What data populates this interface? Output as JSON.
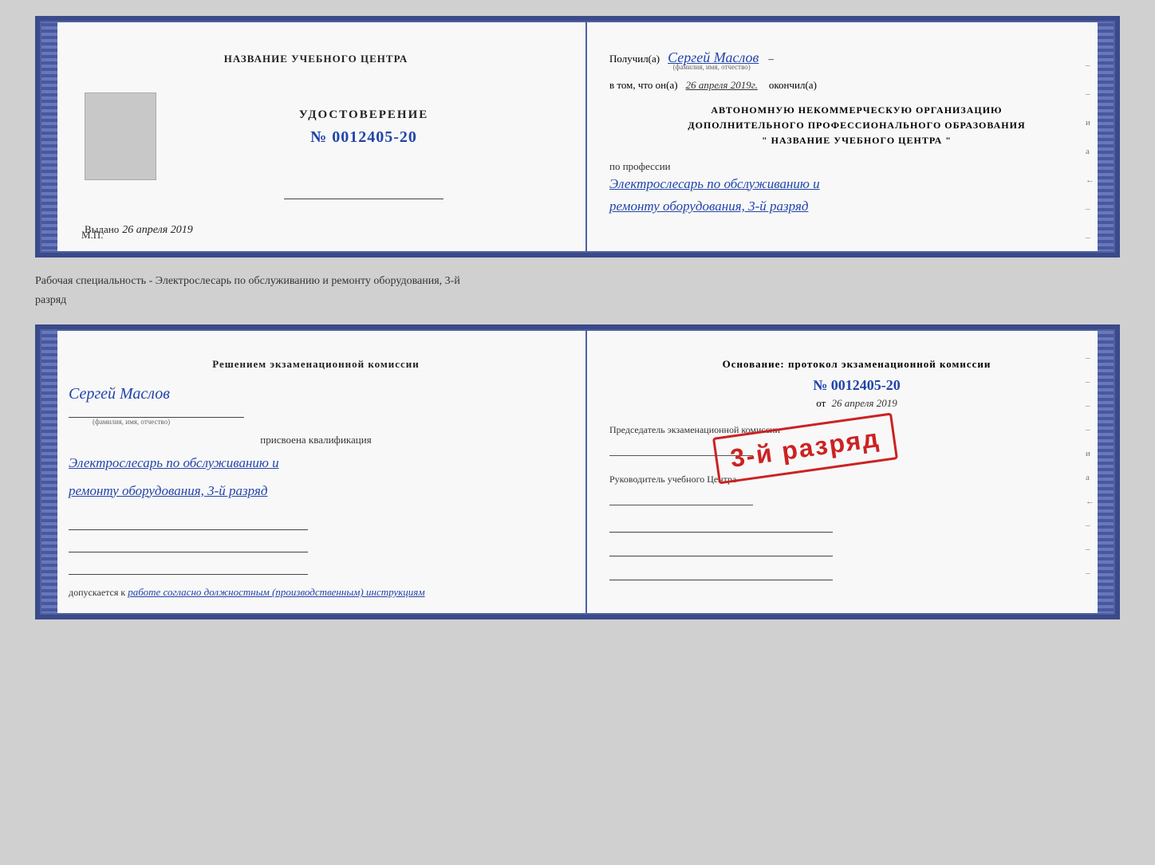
{
  "doc1": {
    "left": {
      "center_title": "НАЗВАНИЕ УЧЕБНОГО ЦЕНТРА",
      "cert_label": "УДОСТОВЕРЕНИЕ",
      "cert_number": "№ 0012405-20",
      "issue_label": "Выдано",
      "issue_date": "26 апреля 2019",
      "mp_label": "М.П."
    },
    "right": {
      "received_label": "Получил(а)",
      "recipient_name": "Сергей Маслов",
      "fio_sub": "(фамилия, имя, отчество)",
      "dash": "–",
      "in_that_label": "в том, что он(а)",
      "completion_date": "26 апреля 2019г.",
      "finished_label": "окончил(а)",
      "org_line1": "АВТОНОМНУЮ НЕКОММЕРЧЕСКУЮ ОРГАНИЗАЦИЮ",
      "org_line2": "ДОПОЛНИТЕЛЬНОГО ПРОФЕССИОНАЛЬНОГО ОБРАЗОВАНИЯ",
      "org_line3": "\" НАЗВАНИЕ УЧЕБНОГО ЦЕНТРА \"",
      "profession_label": "по профессии",
      "profession_text1": "Электрослесарь по обслуживанию и",
      "profession_text2": "ремонту оборудования, 3-й разряд",
      "side_marks": [
        "–",
        "и",
        "а",
        "←",
        "–"
      ]
    }
  },
  "between_text": "Рабочая специальность - Электрослесарь по обслуживанию и ремонту оборудования, 3-й",
  "between_text2": "разряд",
  "doc2": {
    "left": {
      "decision_title": "Решением экзаменационной комиссии",
      "person_name": "Сергей Маслов",
      "fio_sub": "(фамилия, имя, отчество)",
      "assigned_label": "присвоена квалификация",
      "qual_text1": "Электрослесарь по обслуживанию и",
      "qual_text2": "ремонту оборудования, 3-й разряд",
      "allowed_label": "допускается к",
      "allowed_text": "работе согласно должностным (производственным) инструкциям"
    },
    "right": {
      "basis_label": "Основание: протокол экзаменационной комиссии",
      "protocol_number": "№ 0012405-20",
      "from_label": "от",
      "from_date": "26 апреля 2019",
      "chairman_label": "Председатель экзаменационной комиссии",
      "director_label": "Руководитель учебного Центра",
      "stamp_text": "3-й разряд",
      "side_marks": [
        "–",
        "–",
        "–",
        "–",
        "и",
        "а",
        "←",
        "–",
        "–",
        "–"
      ]
    }
  }
}
